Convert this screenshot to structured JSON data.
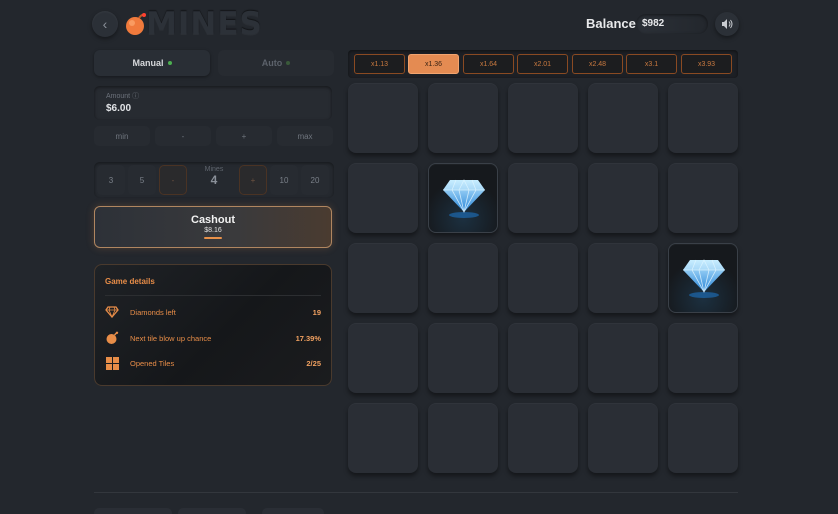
{
  "header": {
    "back_icon": "chevron-left-icon",
    "logo_text": "MINES",
    "balance_label": "Balance:",
    "balance_value": "$982",
    "sound_icon": "speaker-icon"
  },
  "mode_tabs": [
    {
      "label": "Manual",
      "active": true,
      "dot_color": "#4caf50"
    },
    {
      "label": "Auto",
      "active": false,
      "dot_color": "#3a5a3a"
    }
  ],
  "amount": {
    "label": "Amount",
    "value": "$6.00"
  },
  "amount_buttons": [
    "min",
    "-",
    "+",
    "max"
  ],
  "mines_selector": {
    "left_options": [
      "3",
      "5"
    ],
    "decrement": "-",
    "label": "Mines",
    "value": "4",
    "increment": "+",
    "right_options": [
      "10",
      "20"
    ]
  },
  "cashout": {
    "label": "Cashout",
    "amount": "$8.16"
  },
  "game_details": {
    "title": "Game details",
    "rows": [
      {
        "icon": "diamond-icon",
        "label": "Diamonds left",
        "value": "19"
      },
      {
        "icon": "bomb-icon",
        "label": "Next tile blow up chance",
        "value": "17.39%"
      },
      {
        "icon": "grid-icon",
        "label": "Opened Tiles",
        "value": "2/25"
      }
    ]
  },
  "multipliers": [
    {
      "label": "x1.13",
      "active": false
    },
    {
      "label": "x1.36",
      "active": true
    },
    {
      "label": "x1.64",
      "active": false
    },
    {
      "label": "x2.01",
      "active": false
    },
    {
      "label": "x2.48",
      "active": false
    },
    {
      "label": "x3.1",
      "active": false
    },
    {
      "label": "x3.93",
      "active": false
    }
  ],
  "grid": {
    "rows": 5,
    "cols": 5,
    "revealed": [
      {
        "row": 1,
        "col": 1,
        "content": "diamond"
      },
      {
        "row": 2,
        "col": 4,
        "content": "diamond"
      }
    ]
  },
  "colors": {
    "accent": "#e48b52",
    "background": "#23272d"
  }
}
